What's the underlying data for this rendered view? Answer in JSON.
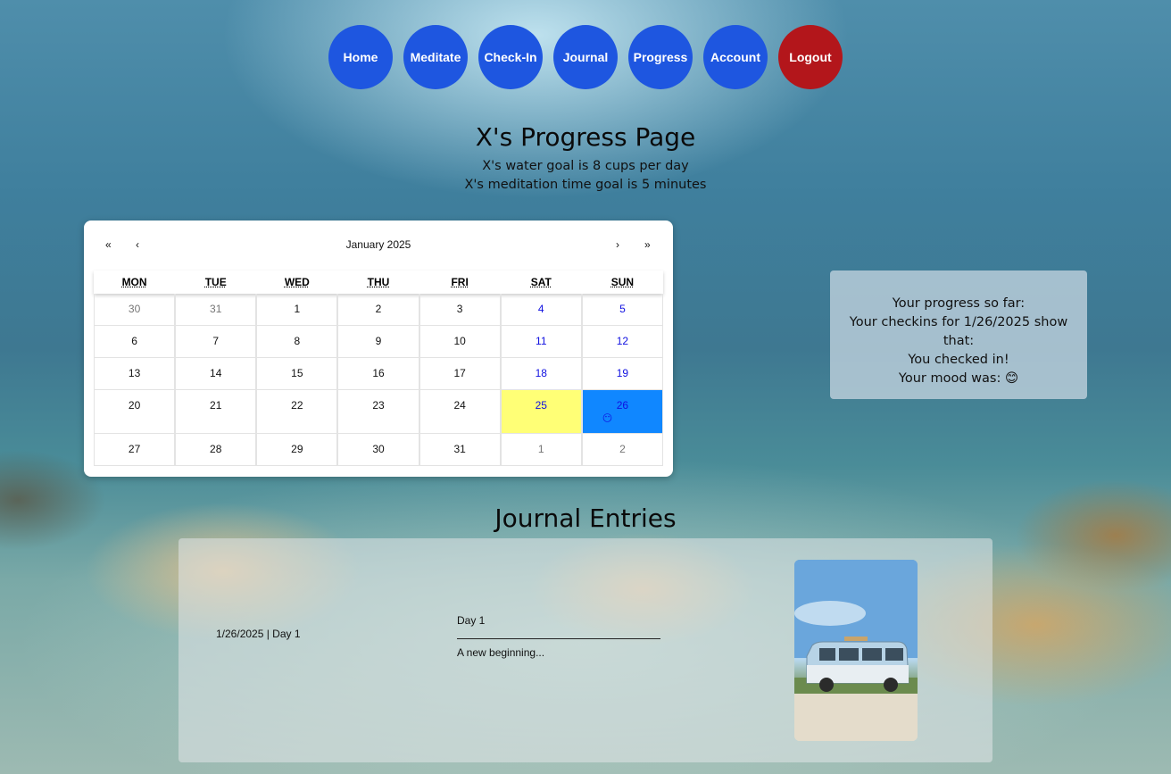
{
  "nav": {
    "items": [
      {
        "label": "Home",
        "name": "nav-home-button"
      },
      {
        "label": "Meditate",
        "name": "nav-meditate-button"
      },
      {
        "label": "Check-In",
        "name": "nav-checkin-button"
      },
      {
        "label": "Journal",
        "name": "nav-journal-button"
      },
      {
        "label": "Progress",
        "name": "nav-progress-button"
      },
      {
        "label": "Account",
        "name": "nav-account-button"
      },
      {
        "label": "Logout",
        "name": "nav-logout-button"
      }
    ],
    "color": "#1e56e0",
    "logout_color": "#b3161b"
  },
  "page": {
    "title": "X's Progress Page",
    "water_goal": "X's water goal is 8 cups per day",
    "meditation_goal": "X's meditation time goal is 5 minutes"
  },
  "calendar": {
    "nav": {
      "first": "«",
      "prev": "‹",
      "label": "January 2025",
      "next": "›",
      "last": "»"
    },
    "weekdays": [
      "MON",
      "TUE",
      "WED",
      "THU",
      "FRI",
      "SAT",
      "SUN"
    ],
    "weeks": [
      [
        "30",
        "31",
        "1",
        "2",
        "3",
        "4",
        "5"
      ],
      [
        "6",
        "7",
        "8",
        "9",
        "10",
        "11",
        "12"
      ],
      [
        "13",
        "14",
        "15",
        "16",
        "17",
        "18",
        "19"
      ],
      [
        "20",
        "21",
        "22",
        "23",
        "24",
        "25",
        "26"
      ],
      [
        "27",
        "28",
        "29",
        "30",
        "31",
        "1",
        "2"
      ]
    ],
    "today": "25",
    "selected": "26",
    "selected_mood": "😶",
    "today_color": "#ffff76",
    "selected_color": "#1087ff"
  },
  "progress": {
    "heading": "Your progress so far:",
    "checkins": "Your checkins for 1/26/2025 show that:",
    "checked_in": "You checked in!",
    "mood": "Your mood was: 😊"
  },
  "journal": {
    "title": "Journal Entries",
    "entries": [
      {
        "date": "1/26/2025 | Day 1",
        "title": "Day 1",
        "body": "A new beginning..."
      }
    ]
  }
}
